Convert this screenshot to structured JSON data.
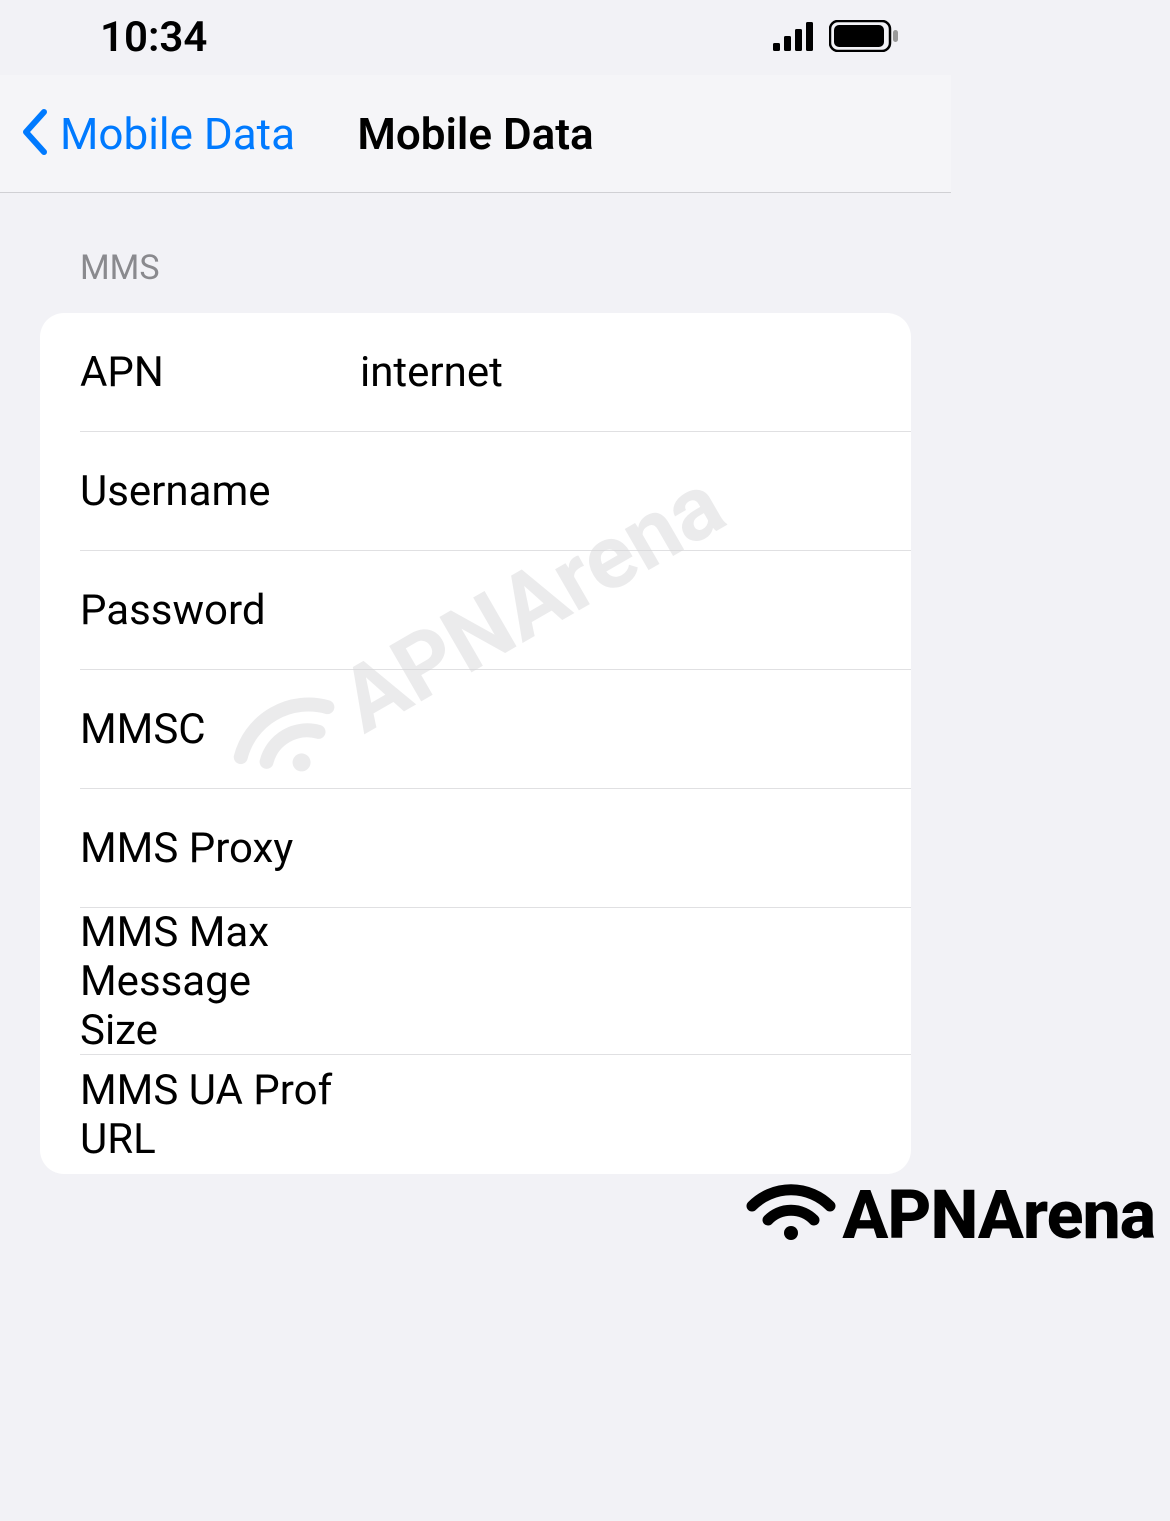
{
  "statusBar": {
    "time": "10:34"
  },
  "navBar": {
    "backLabel": "Mobile Data",
    "title": "Mobile Data"
  },
  "section": {
    "header": "MMS",
    "rows": [
      {
        "label": "APN",
        "value": "internet"
      },
      {
        "label": "Username",
        "value": ""
      },
      {
        "label": "Password",
        "value": ""
      },
      {
        "label": "MMSC",
        "value": ""
      },
      {
        "label": "MMS Proxy",
        "value": ""
      },
      {
        "label": "MMS Max Message Size",
        "value": ""
      },
      {
        "label": "MMS UA Prof URL",
        "value": ""
      }
    ]
  },
  "watermark": {
    "text": "APNArena"
  }
}
